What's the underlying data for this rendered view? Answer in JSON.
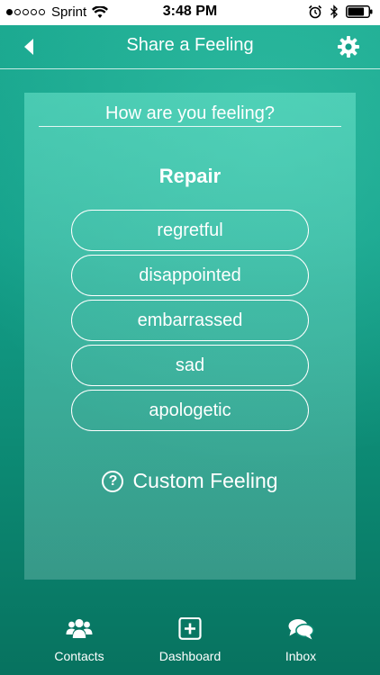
{
  "status_bar": {
    "carrier": "Sprint",
    "time": "3:48 PM",
    "signal_bars_filled": 1,
    "signal_bars_total": 5,
    "battery_level": 0.8
  },
  "header": {
    "title": "Share a Feeling",
    "back_icon": "back-arrow-icon",
    "settings_icon": "gear-icon"
  },
  "panel": {
    "question": "How are you feeling?",
    "category": "Repair",
    "feelings": [
      {
        "label": "regretful"
      },
      {
        "label": "disappointed"
      },
      {
        "label": "embarrassed"
      },
      {
        "label": "sad"
      },
      {
        "label": "apologetic"
      }
    ],
    "custom_feeling": {
      "label": "Custom Feeling",
      "icon": "help-icon"
    }
  },
  "tab_bar": {
    "tabs": [
      {
        "label": "Contacts",
        "icon": "contacts-icon"
      },
      {
        "label": "Dashboard",
        "icon": "dashboard-icon"
      },
      {
        "label": "Inbox",
        "icon": "inbox-icon"
      }
    ]
  },
  "colors": {
    "background_top": "#1aa88f",
    "background_bottom": "#07725f",
    "text": "#ffffff"
  }
}
